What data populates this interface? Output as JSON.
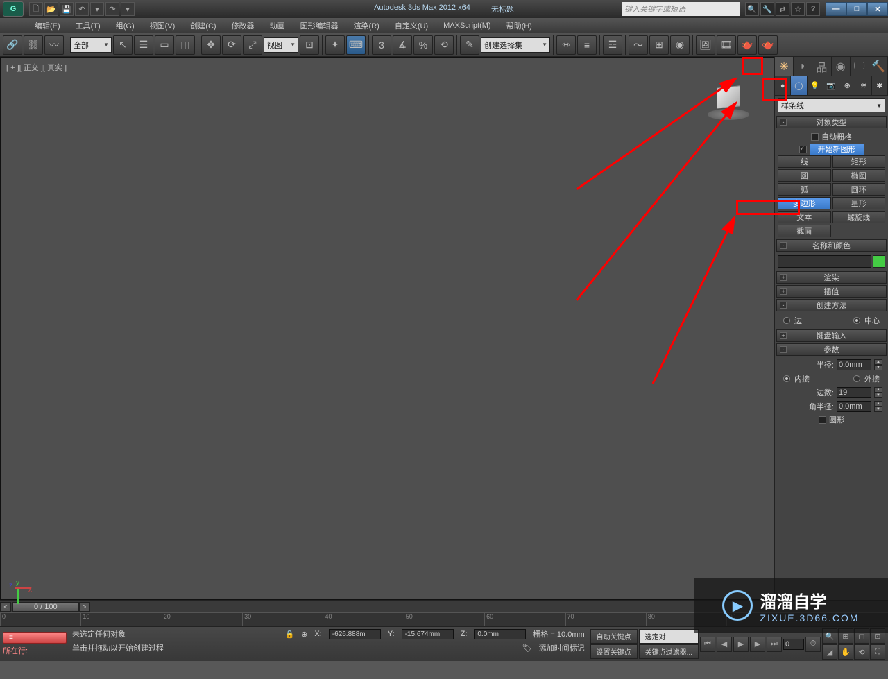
{
  "title": {
    "app": "Autodesk 3ds Max 2012 x64",
    "doc": "无标题"
  },
  "search_placeholder": "键入关键字或短语",
  "menu": [
    "编辑(E)",
    "工具(T)",
    "组(G)",
    "视图(V)",
    "创建(C)",
    "修改器",
    "动画",
    "图形编辑器",
    "渲染(R)",
    "自定义(U)",
    "MAXScript(M)",
    "帮助(H)"
  ],
  "toolbar": {
    "filter": "全部",
    "viewsel": "视图",
    "named_sel": "创建选择集"
  },
  "viewport_label": "[ + ][ 正交 ][ 真实 ]",
  "cmd": {
    "dropdown": "样条线",
    "rollout_object": "对象类型",
    "autogrid": "自动栅格",
    "newshape": "开始新图形",
    "buttons": [
      [
        "线",
        "矩形"
      ],
      [
        "圆",
        "椭圆"
      ],
      [
        "弧",
        "圆环"
      ],
      [
        "多边形",
        "星形"
      ],
      [
        "文本",
        "螺旋线"
      ],
      [
        "截面",
        ""
      ]
    ],
    "selected": "多边形",
    "rollout_name": "名称和颜色",
    "rollout_render": "渲染",
    "rollout_interp": "插值",
    "rollout_create": "创建方法",
    "create_edge": "边",
    "create_center": "中心",
    "rollout_keyboard": "键盘输入",
    "rollout_params": "参数",
    "radius_l": "半径:",
    "radius_v": "0.0mm",
    "inscribed": "内接",
    "circum": "外接",
    "sides_l": "边数:",
    "sides_v": "19",
    "corner_l": "角半径:",
    "corner_v": "0.0mm",
    "circular": "圆形"
  },
  "timeslider": "0 / 100",
  "status": {
    "script_label": "所在行:",
    "none_selected": "未选定任何对象",
    "prompt": "单击并拖动以开始创建过程",
    "x": "-626.888m",
    "y": "-15.674mm",
    "z": "0.0mm",
    "grid": "栅格 = 10.0mm",
    "add_time": "添加时间标记",
    "autokey": "自动关键点",
    "setkey": "设置关键点",
    "selobj": "选定对",
    "keyfilter": "关键点过滤器..."
  },
  "watermark": {
    "brand": "溜溜自学",
    "url": "ZIXUE.3D66.COM"
  }
}
